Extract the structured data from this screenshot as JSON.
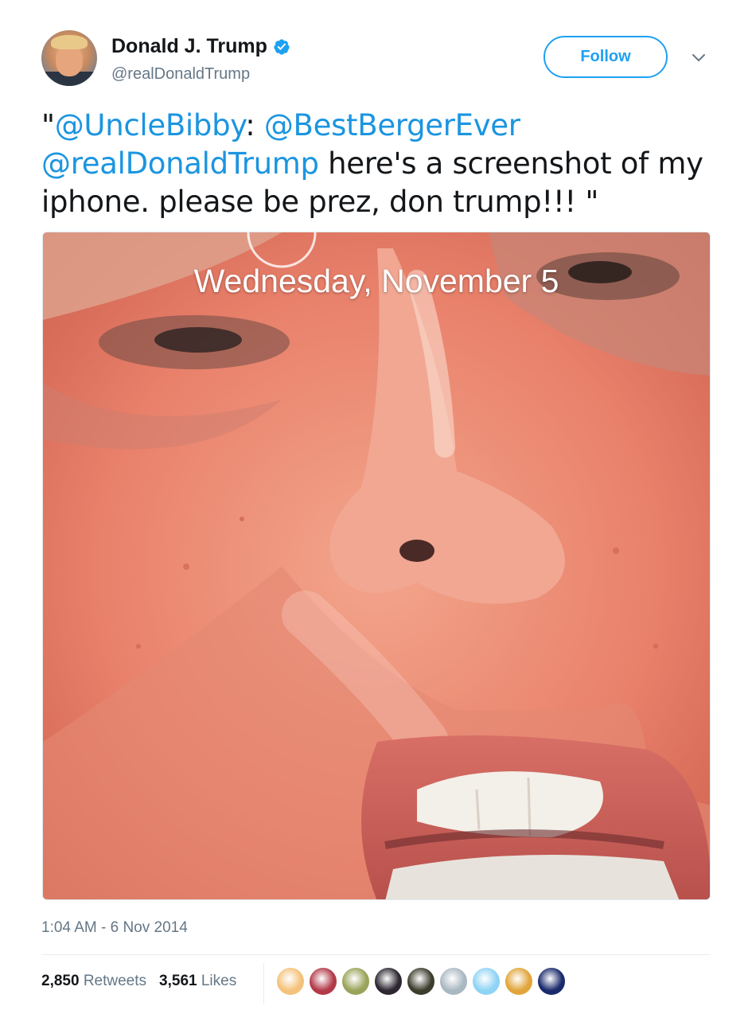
{
  "header": {
    "display_name": "Donald J. Trump",
    "handle": "@realDonaldTrump",
    "follow_label": "Follow",
    "verified_icon": "verified-badge-icon",
    "menu_icon": "chevron-down-icon"
  },
  "tweet": {
    "open_quote": "\"",
    "mention_1": "@UncleBibby",
    "colon": ": ",
    "mention_2": "@BestBergerEver",
    "mention_3": "@realDonaldTrump",
    "body": " here's a screenshot of my iphone. please be prez, don trump!!! \""
  },
  "media": {
    "lock_screen_date": "Wednesday, November 5"
  },
  "meta": {
    "timestamp": "1:04 AM - 6 Nov 2014"
  },
  "stats": {
    "retweets_count": "2,850",
    "retweets_label": "Retweets",
    "likes_count": "3,561",
    "likes_label": "Likes"
  },
  "likers": [
    {
      "name": "liker-avatar",
      "color": "#f4c27a"
    },
    {
      "name": "liker-avatar",
      "color": "#b23a48"
    },
    {
      "name": "liker-avatar",
      "color": "#9aa35a"
    },
    {
      "name": "liker-avatar",
      "color": "#2c2730"
    },
    {
      "name": "liker-avatar",
      "color": "#3d3d2e"
    },
    {
      "name": "liker-avatar",
      "color": "#aab8c2"
    },
    {
      "name": "liker-avatar",
      "color": "#8fd3f5"
    },
    {
      "name": "liker-avatar",
      "color": "#e1a53a"
    },
    {
      "name": "liker-avatar",
      "color": "#1a2a6c"
    }
  ],
  "colors": {
    "accent": "#1da1f2",
    "mention": "#1b95e0",
    "secondary_text": "#657786"
  }
}
